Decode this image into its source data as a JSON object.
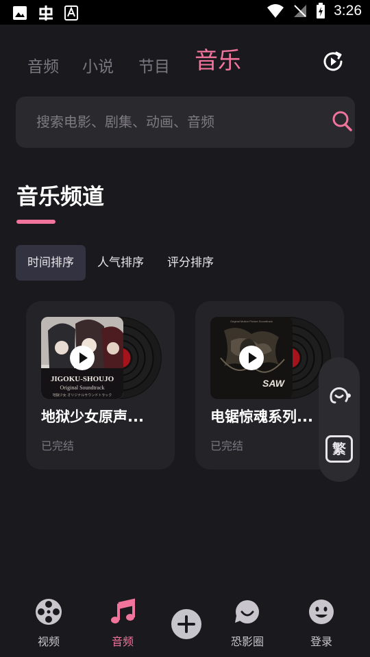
{
  "status_bar": {
    "time": "3:26"
  },
  "top_tabs": [
    {
      "label": "音频",
      "active": false
    },
    {
      "label": "小说",
      "active": false
    },
    {
      "label": "节目",
      "active": false
    },
    {
      "label": "音乐",
      "active": true
    }
  ],
  "search": {
    "placeholder": "搜索电影、剧集、动画、音频"
  },
  "section": {
    "title": "音乐频道"
  },
  "sort_options": [
    {
      "label": "时间排序",
      "active": true
    },
    {
      "label": "人气排序",
      "active": false
    },
    {
      "label": "评分排序",
      "active": false
    }
  ],
  "cards": [
    {
      "title": "地狱少女原声...",
      "status": "已完结",
      "cover_text": "JIGOKU-SHOUJO",
      "cover_subtext": "Original Soundtrack",
      "cover_small": "地獄少女 オリジナルサウンドトラック"
    },
    {
      "title": "电锯惊魂系列...",
      "status": "已完结",
      "cover_text": "SAW",
      "cover_subtext": "Original Motion Picture Soundtrack"
    }
  ],
  "float_panel": {
    "traditional_label": "繁"
  },
  "bottom_nav": [
    {
      "label": "视频",
      "icon": "film-reel-icon",
      "active": false
    },
    {
      "label": "音频",
      "icon": "music-note-icon",
      "active": true
    },
    {
      "label": "恐影圈",
      "icon": "smile-bubble-icon",
      "active": false
    },
    {
      "label": "登录",
      "icon": "smiley-face-icon",
      "active": false
    }
  ],
  "colors": {
    "accent": "#f0749c",
    "background": "#1a191d",
    "card": "#242328"
  }
}
